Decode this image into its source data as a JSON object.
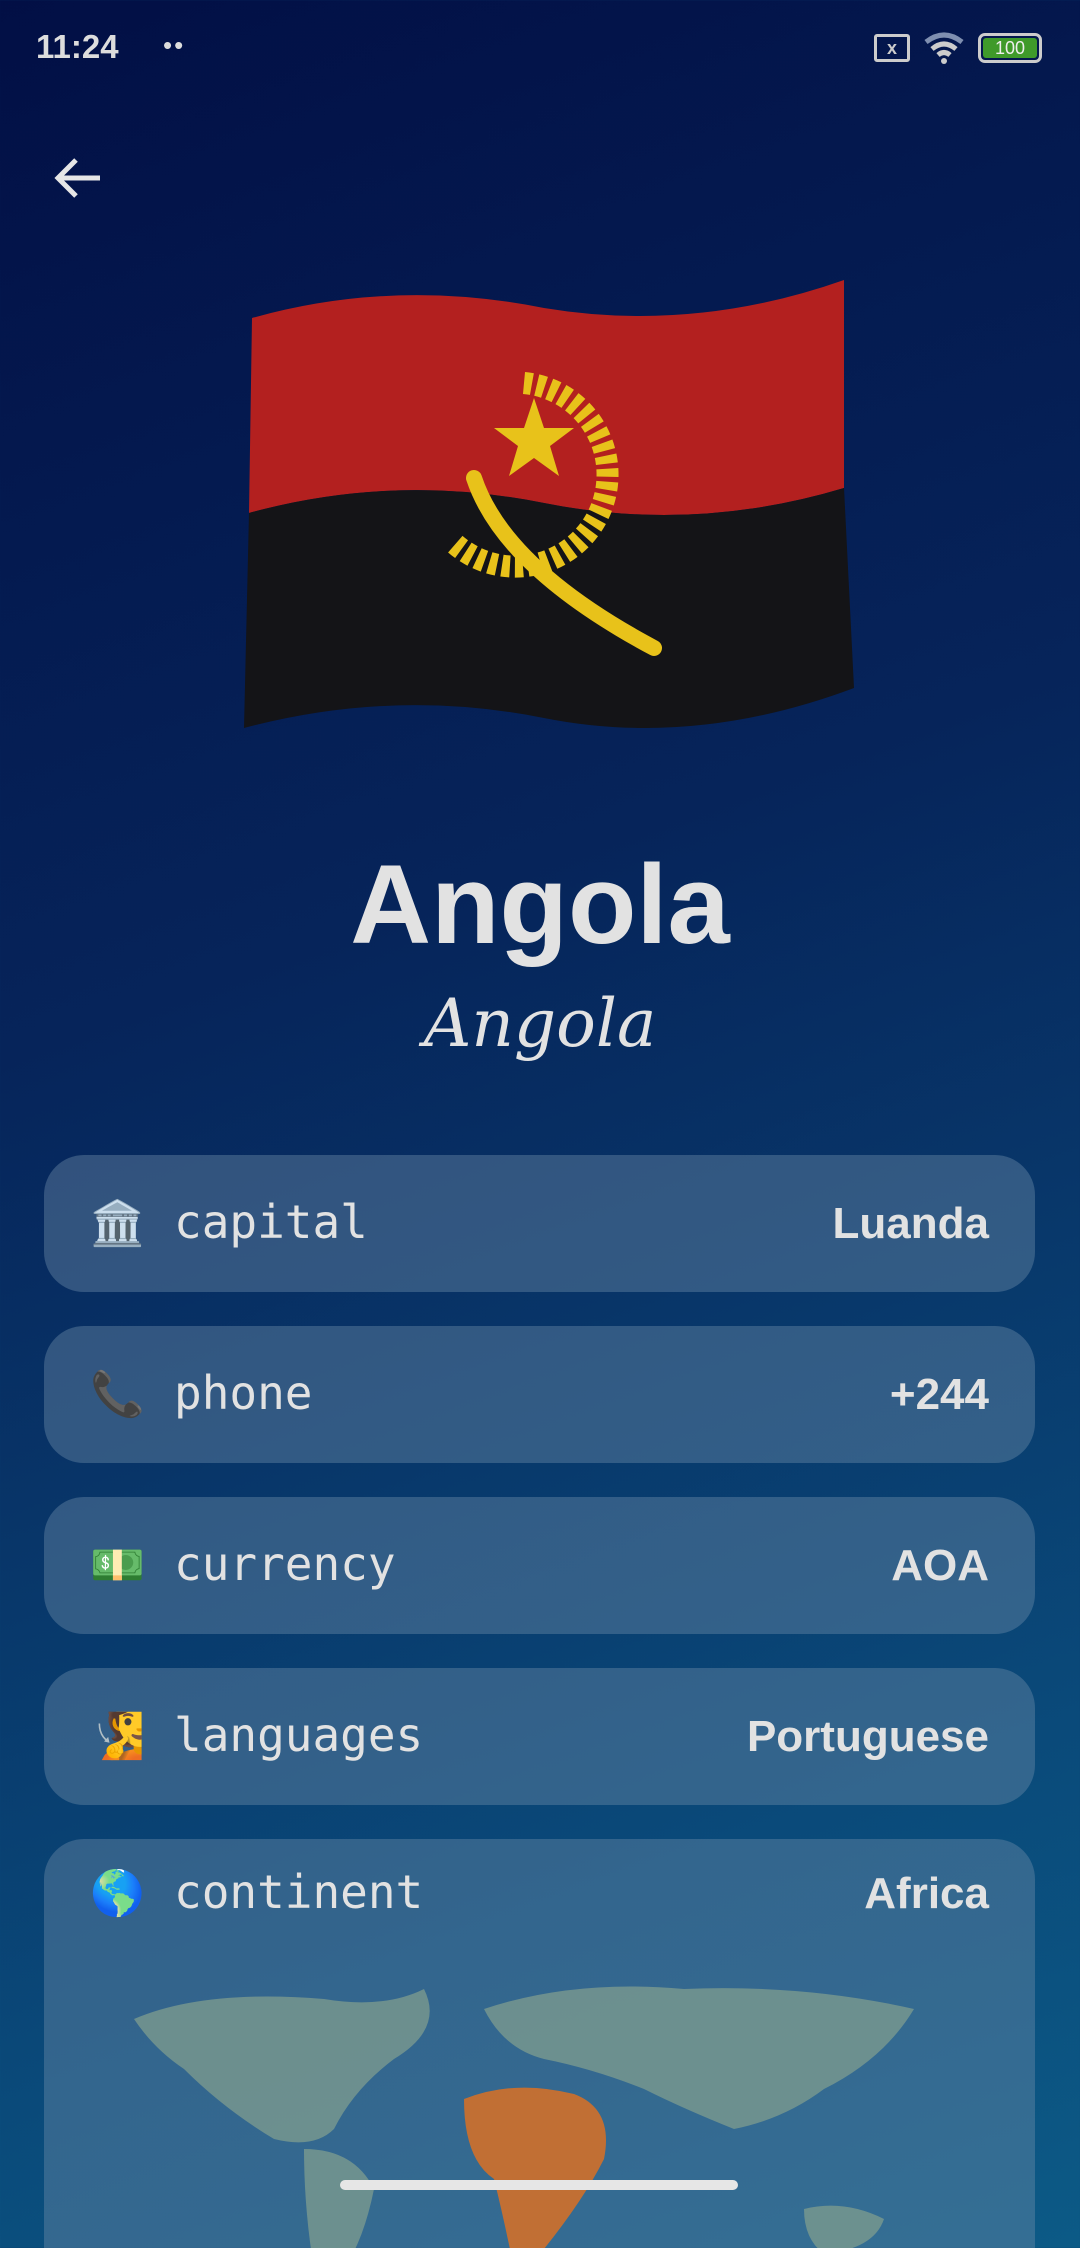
{
  "status_bar": {
    "time": "11:24",
    "dots": "••",
    "sim_icon": "no-sim-icon",
    "wifi_icon": "wifi-icon",
    "battery": "100"
  },
  "header": {
    "back_icon": "arrow-left-icon"
  },
  "country": {
    "name": "Angola",
    "native_name": "Angola",
    "flag_colors": {
      "red": "#b3201f",
      "black": "#141417",
      "yellow": "#e8c21a"
    }
  },
  "details": [
    {
      "icon": "🏛️",
      "label": "capital",
      "value": "Luanda"
    },
    {
      "icon": "📞",
      "label": "phone",
      "value": "+244"
    },
    {
      "icon": "💵",
      "label": "currency",
      "value": "AOA"
    },
    {
      "icon": "🧏",
      "label": "languages",
      "value": "Portuguese"
    },
    {
      "icon": "🌎",
      "label": "continent",
      "value": "Africa"
    }
  ]
}
